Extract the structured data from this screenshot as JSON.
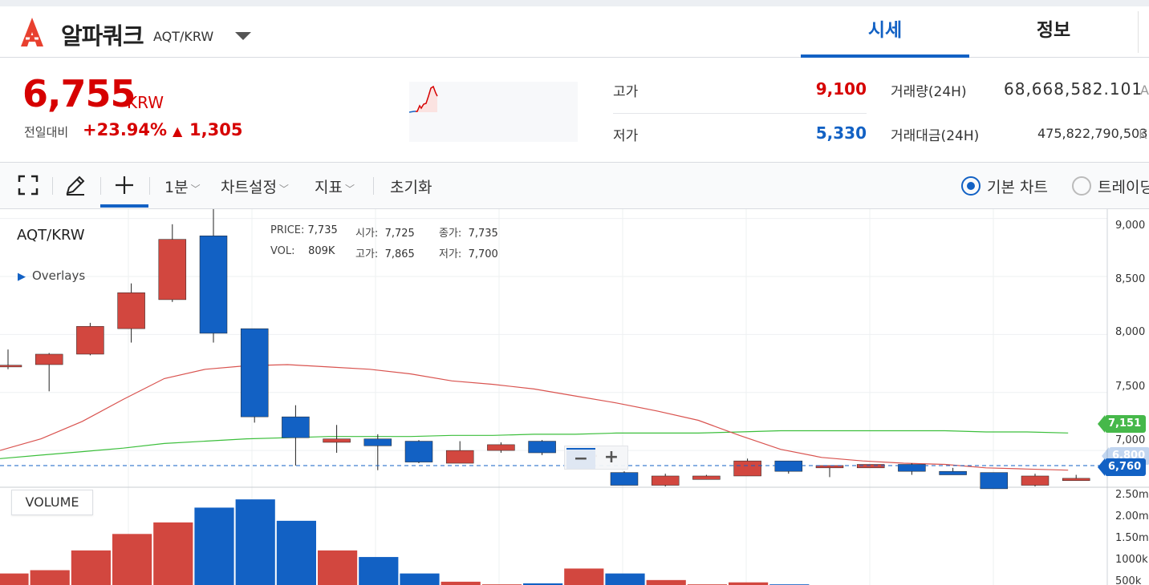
{
  "header": {
    "coin_name": "알파쿼크",
    "pair": "AQT/KRW",
    "tabs": [
      {
        "label": "시세",
        "active": true
      },
      {
        "label": "정보",
        "active": false
      }
    ]
  },
  "summary": {
    "price": "6,755",
    "unit": "KRW",
    "change_label": "전일대비",
    "change_rate": "+23.94%",
    "change_arrow": "▲",
    "change_amount": "1,305",
    "high_label": "고가",
    "high_value": "9,100",
    "low_label": "저가",
    "low_value": "5,330",
    "volume_label": "거래량(24H)",
    "volume_value": "68,668,582.101",
    "volume_unit": "A",
    "trade_amount_label": "거래대금(24H)",
    "trade_amount_value": "475,822,790,503",
    "trade_amount_unit": "K"
  },
  "toolbar": {
    "interval": "1분",
    "chart_settings": "차트설정",
    "indicators": "지표",
    "reset": "초기화",
    "basic_chart": "기본 차트",
    "trading_view": "트레이딩"
  },
  "chart": {
    "pair_label": "AQT/KRW",
    "overlays_label": "Overlays",
    "legend": {
      "price_key": "PRICE:",
      "price": "7,735",
      "open_key": "시가:",
      "open": "7,725",
      "close_key": "종가:",
      "close": "7,735",
      "vol_key": "VOL:",
      "vol": "809K",
      "high_key": "고가:",
      "high": "7,865",
      "low_key": "저가:",
      "low": "7,700"
    },
    "ma_green_tag": "7,151",
    "last_price_tag": "6,760",
    "hidden_tag": "6,800",
    "volume_label": "VOLUME",
    "zoom_minus": "−",
    "zoom_plus": "+",
    "price_ticks": [
      "9,000",
      "8,500",
      "8,000",
      "7,500",
      "7,000"
    ],
    "volume_ticks": [
      "2.50m",
      "2.00m",
      "1.50m",
      "1000k",
      "500k"
    ],
    "colors": {
      "up": "#d2473f",
      "down": "#1261c4",
      "ma_red": "#d9534f",
      "ma_green": "#3cbf3c",
      "tag_green": "#46b84a",
      "tag_blue": "#1261c4"
    }
  },
  "chart_data": {
    "type": "candlestick",
    "price_axis": [
      6690,
      9080
    ],
    "candles": [
      {
        "o": 7720,
        "h": 7870,
        "l": 7700,
        "c": 7735
      },
      {
        "o": 7740,
        "h": 7840,
        "l": 7510,
        "c": 7830
      },
      {
        "o": 7830,
        "h": 8100,
        "l": 7820,
        "c": 8070
      },
      {
        "o": 8050,
        "h": 8440,
        "l": 7930,
        "c": 8360
      },
      {
        "o": 8300,
        "h": 8950,
        "l": 8280,
        "c": 8820
      },
      {
        "o": 8850,
        "h": 9100,
        "l": 7930,
        "c": 8010
      },
      {
        "o": 8050,
        "h": 8050,
        "l": 7240,
        "c": 7290
      },
      {
        "o": 7290,
        "h": 7390,
        "l": 6870,
        "c": 7110
      },
      {
        "o": 7070,
        "h": 7220,
        "l": 6980,
        "c": 7100
      },
      {
        "o": 7100,
        "h": 7140,
        "l": 6830,
        "c": 7040
      },
      {
        "o": 7080,
        "h": 7090,
        "l": 6890,
        "c": 6900
      },
      {
        "o": 6890,
        "h": 7080,
        "l": 6890,
        "c": 7000
      },
      {
        "o": 7000,
        "h": 7070,
        "l": 6980,
        "c": 7050
      },
      {
        "o": 7080,
        "h": 7090,
        "l": 6960,
        "c": 6980
      },
      {
        "o": 6960,
        "h": 6980,
        "l": 6920,
        "c": 6960
      },
      {
        "o": 6810,
        "h": 6820,
        "l": 6700,
        "c": 6700
      },
      {
        "o": 6700,
        "h": 6800,
        "l": 6690,
        "c": 6780
      },
      {
        "o": 6750,
        "h": 6790,
        "l": 6750,
        "c": 6780
      },
      {
        "o": 6780,
        "h": 6930,
        "l": 6780,
        "c": 6910
      },
      {
        "o": 6910,
        "h": 6910,
        "l": 6800,
        "c": 6820
      },
      {
        "o": 6850,
        "h": 6870,
        "l": 6770,
        "c": 6870
      },
      {
        "o": 6850,
        "h": 6880,
        "l": 6850,
        "c": 6880
      },
      {
        "o": 6880,
        "h": 6890,
        "l": 6790,
        "c": 6820
      },
      {
        "o": 6820,
        "h": 6850,
        "l": 6800,
        "c": 6790
      },
      {
        "o": 6810,
        "h": 6810,
        "l": 6680,
        "c": 6670
      },
      {
        "o": 6700,
        "h": 6800,
        "l": 6690,
        "c": 6780
      },
      {
        "o": 6740,
        "h": 6790,
        "l": 6740,
        "c": 6760
      }
    ],
    "ma_red": [
      7000,
      7100,
      7250,
      7440,
      7620,
      7700,
      7730,
      7740,
      7720,
      7700,
      7660,
      7600,
      7570,
      7530,
      7470,
      7410,
      7340,
      7260,
      7130,
      7010,
      6940,
      6910,
      6890,
      6880,
      6850,
      6840,
      6830
    ],
    "ma_green": [
      6930,
      6960,
      6990,
      7020,
      7060,
      7080,
      7100,
      7110,
      7120,
      7120,
      7120,
      7130,
      7130,
      7140,
      7140,
      7150,
      7150,
      7150,
      7160,
      7170,
      7170,
      7170,
      7170,
      7170,
      7160,
      7160,
      7151
    ],
    "volume": [
      0.35,
      0.45,
      1.05,
      1.55,
      1.9,
      2.35,
      2.6,
      1.95,
      1.05,
      0.85,
      0.35,
      0.1,
      0.02,
      0.05,
      0.5,
      0.35,
      0.15,
      0.02,
      0.08,
      0.02,
      0.0,
      0.0,
      0.0,
      0.0,
      0.0,
      0.0,
      0.0
    ],
    "volume_axis": [
      0,
      2.75
    ]
  }
}
